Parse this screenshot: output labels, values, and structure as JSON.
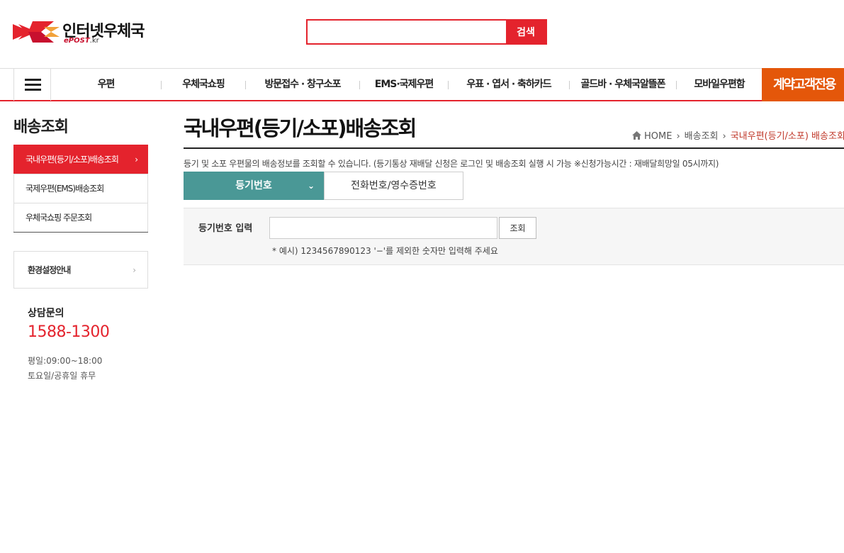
{
  "header": {
    "logo_text": "인터넷우체국",
    "logo_sub_brand": "ePOST",
    "logo_sub_domain": ".kr",
    "search_placeholder": "",
    "search_button": "검색"
  },
  "gnb": {
    "items": [
      {
        "label": "우편"
      },
      {
        "label": "우체국쇼핑"
      },
      {
        "label": "방문접수 · 창구소포"
      },
      {
        "label": "EMS·국제우편"
      },
      {
        "label": "우표 · 엽서 · 축하카드"
      },
      {
        "label": "골드바 · 우체국알뜰폰"
      },
      {
        "label": "모바일우편함"
      }
    ],
    "contract": "계약고객전용"
  },
  "lnb": {
    "title": "배송조회",
    "items": [
      {
        "label": "국내우편(등기/소포)배송조회",
        "arrow": "›"
      },
      {
        "label": "국제우편(EMS)배송조회"
      },
      {
        "label": "우체국쇼핑 주문조회"
      }
    ],
    "env_label": "환경설정안내",
    "env_arrow": "›",
    "cs_title": "상담문의",
    "cs_phone": "1588-1300",
    "cs_hours_weekday": "평일:09:00~18:00",
    "cs_hours_weekend": "토요일/공휴일 휴무"
  },
  "content": {
    "title": "국내우편(등기/소포)배송조회",
    "breadcrumb": [
      "HOME",
      "배송조회",
      "국내우편(등기/소포) 배송조회"
    ],
    "breadcrumb_sep": "›",
    "description": "등기 및 소포 우편물의 배송정보를 조회할 수 있습니다. (등기통상 재배달 신청은 로그인 및 배송조회 실행 시 가능 ※신청가능시간 : 재배달희망일 05시까지)",
    "tabs": [
      {
        "label": "등기번호",
        "chevron": "⌄"
      },
      {
        "label": "전화번호/영수증번호"
      }
    ],
    "form": {
      "label": "등기번호 입력",
      "input_value": "",
      "button": "조회",
      "hint": "* 예시) 1234567890123 '−'를 제외한 숫자만 입력해 주세요"
    }
  },
  "colors": {
    "brand_red": "#e4232d",
    "contract_orange": "#e4570a",
    "tab_teal": "#4a9896"
  }
}
